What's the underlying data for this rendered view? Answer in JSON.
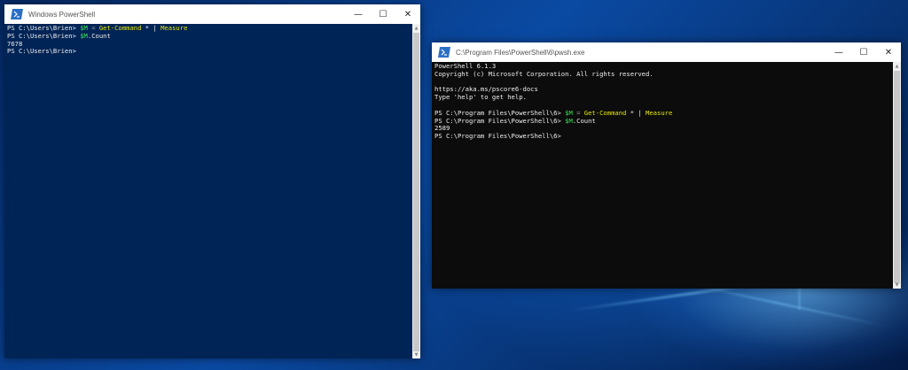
{
  "window1": {
    "title": "Windows PowerShell",
    "minimize": "—",
    "maximize": "☐",
    "close": "✕",
    "background": "#012456",
    "lines": [
      {
        "prompt": "PS C:\\Users\\Brien> ",
        "var": "$M",
        "op": " = ",
        "cmd": "Get-Command",
        "rest": " * ",
        "pipe": "| ",
        "cmd2": "Measure",
        "text": "",
        "prop": ""
      },
      {
        "prompt": "PS C:\\Users\\Brien> ",
        "var": "$M",
        "op": "",
        "cmd": "",
        "rest": "",
        "pipe": "",
        "cmd2": "",
        "text": "",
        "prop": ".Count"
      },
      {
        "prompt": "",
        "var": "",
        "op": "",
        "cmd": "",
        "rest": "",
        "pipe": "",
        "cmd2": "",
        "text": "7678",
        "prop": ""
      },
      {
        "prompt": "PS C:\\Users\\Brien> ",
        "var": "",
        "op": "",
        "cmd": "",
        "rest": "",
        "pipe": "",
        "cmd2": "",
        "text": "",
        "prop": ""
      }
    ]
  },
  "window2": {
    "title": "C:\\Program Files\\PowerShell\\6\\pwsh.exe",
    "minimize": "—",
    "maximize": "☐",
    "close": "✕",
    "background": "#0c0c0c",
    "lines": [
      {
        "prompt": "",
        "var": "",
        "op": "",
        "cmd": "",
        "rest": "",
        "pipe": "",
        "cmd2": "",
        "text": "PowerShell 6.1.3",
        "prop": ""
      },
      {
        "prompt": "",
        "var": "",
        "op": "",
        "cmd": "",
        "rest": "",
        "pipe": "",
        "cmd2": "",
        "text": "Copyright (c) Microsoft Corporation. All rights reserved.",
        "prop": ""
      },
      {
        "prompt": "",
        "var": "",
        "op": "",
        "cmd": "",
        "rest": "",
        "pipe": "",
        "cmd2": "",
        "text": "",
        "prop": ""
      },
      {
        "prompt": "",
        "var": "",
        "op": "",
        "cmd": "",
        "rest": "",
        "pipe": "",
        "cmd2": "",
        "text": "https://aka.ms/pscore6-docs",
        "prop": ""
      },
      {
        "prompt": "",
        "var": "",
        "op": "",
        "cmd": "",
        "rest": "",
        "pipe": "",
        "cmd2": "",
        "text": "Type 'help' to get help.",
        "prop": ""
      },
      {
        "prompt": "",
        "var": "",
        "op": "",
        "cmd": "",
        "rest": "",
        "pipe": "",
        "cmd2": "",
        "text": "",
        "prop": ""
      },
      {
        "prompt": "PS C:\\Program Files\\PowerShell\\6> ",
        "var": "$M",
        "op": " = ",
        "cmd": "Get-Command",
        "rest": " * ",
        "pipe": "| ",
        "cmd2": "Measure",
        "text": "",
        "prop": ""
      },
      {
        "prompt": "PS C:\\Program Files\\PowerShell\\6> ",
        "var": "$M",
        "op": "",
        "cmd": "",
        "rest": "",
        "pipe": "",
        "cmd2": "",
        "text": "",
        "prop": ".Count"
      },
      {
        "prompt": "",
        "var": "",
        "op": "",
        "cmd": "",
        "rest": "",
        "pipe": "",
        "cmd2": "",
        "text": "2589",
        "prop": ""
      },
      {
        "prompt": "PS C:\\Program Files\\PowerShell\\6> ",
        "var": "",
        "op": "",
        "cmd": "",
        "rest": "",
        "pipe": "",
        "cmd2": "",
        "text": "",
        "prop": ""
      }
    ]
  },
  "icons": {
    "app": "powershell-icon",
    "minimize": "minimize-icon",
    "maximize": "maximize-icon",
    "close": "close-icon"
  }
}
